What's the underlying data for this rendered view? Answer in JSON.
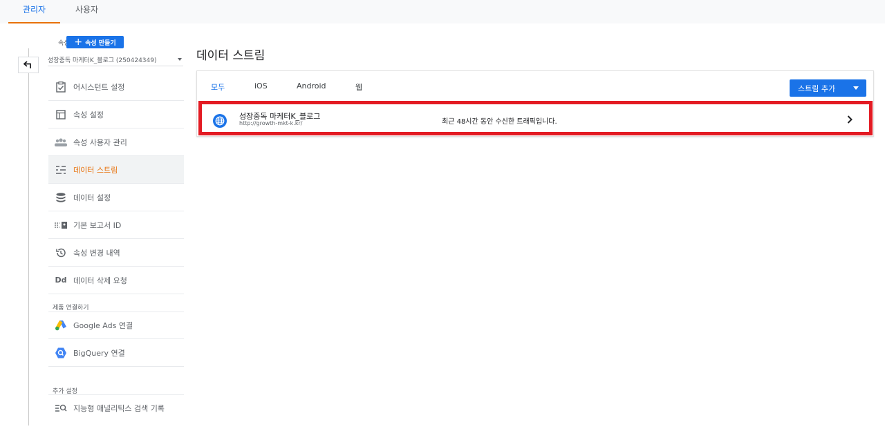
{
  "top_tabs": [
    {
      "label": "관리자",
      "active": true
    },
    {
      "label": "사용자",
      "active": false
    }
  ],
  "sidebar": {
    "property_label": "속성",
    "create_property_label": "속성 만들기",
    "selected_property": "성장중독 마케터K_블로그 (250424349)",
    "items": [
      {
        "label": "어시스턴트 설정",
        "icon": "checklist-icon",
        "active": false
      },
      {
        "label": "속성 설정",
        "icon": "layout-icon",
        "active": false
      },
      {
        "label": "속성 사용자 관리",
        "icon": "people-icon",
        "active": false
      },
      {
        "label": "데이터 스트림",
        "icon": "streams-icon",
        "active": true
      },
      {
        "label": "데이터 설정",
        "icon": "database-icon",
        "active": false
      },
      {
        "label": "기본 보고서 ID",
        "icon": "report-id-icon",
        "active": false
      },
      {
        "label": "속성 변경 내역",
        "icon": "history-icon",
        "active": false
      },
      {
        "label": "데이터 삭제 요청",
        "icon": "dd-icon",
        "active": false
      }
    ],
    "product_links_heading": "제품 연결하기",
    "product_links": [
      {
        "label": "Google Ads 연결",
        "icon": "google-ads-icon"
      },
      {
        "label": "BigQuery 연결",
        "icon": "bigquery-icon"
      }
    ],
    "additional_heading": "추가 설정",
    "additional_items": [
      {
        "label": "지능형 애널리틱스 검색 기록",
        "icon": "search-history-icon"
      }
    ]
  },
  "main": {
    "title": "데이터 스트림",
    "filters": [
      {
        "label": "모두",
        "active": true
      },
      {
        "label": "iOS",
        "active": false
      },
      {
        "label": "Android",
        "active": false
      },
      {
        "label": "웹",
        "active": false
      }
    ],
    "add_stream_label": "스트림 추가",
    "streams": [
      {
        "name": "성장중독 마케터K_블로그",
        "url": "http://growth-mkt-k.kr/",
        "status": "최근 48시간 동안 수신한 트래픽입니다."
      }
    ]
  },
  "colors": {
    "accent": "#1a73e8",
    "active_nav": "#e8710a",
    "highlight_border": "#e31b23"
  }
}
